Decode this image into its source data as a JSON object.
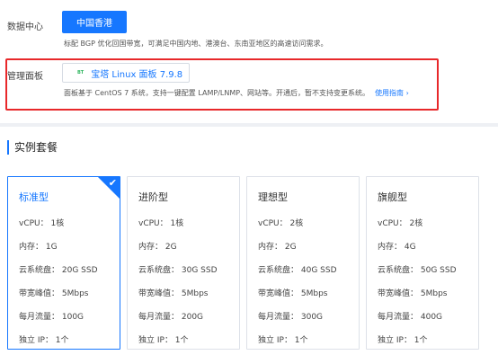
{
  "datacenter": {
    "label": "数据中心",
    "selected_region": "中国香港",
    "description": "标配 BGP 优化回国带宽，可满足中国内地、港澳台、东南亚地区的高速访问需求。"
  },
  "management_panel": {
    "label": "管理面板",
    "selected_panel": "宝塔 Linux 面板 7.9.8",
    "logo_text": "BT",
    "description": "面板基于 CentOS 7 系统，支持一键配置 LAMP/LNMP、网站等。开通后，暂不支持变更系统。",
    "guide_link": "使用指南 ›"
  },
  "plans_section": {
    "title": "实例套餐",
    "plans": [
      {
        "name": "标准型",
        "selected": true,
        "specs": [
          "vCPU：  1核",
          "内存：  1G",
          "云系统盘：  20G SSD",
          "带宽峰值：  5Mbps",
          "每月流量：  100G",
          "独立 IP：  1个"
        ]
      },
      {
        "name": "进阶型",
        "selected": false,
        "specs": [
          "vCPU：  1核",
          "内存：  2G",
          "云系统盘：  30G SSD",
          "带宽峰值：  5Mbps",
          "每月流量：  200G",
          "独立 IP：  1个"
        ]
      },
      {
        "name": "理想型",
        "selected": false,
        "specs": [
          "vCPU：  2核",
          "内存：  2G",
          "云系统盘：  40G SSD",
          "带宽峰值：  5Mbps",
          "每月流量：  300G",
          "独立 IP：  1个"
        ]
      },
      {
        "name": "旗舰型",
        "selected": false,
        "specs": [
          "vCPU：  2核",
          "内存：  4G",
          "云系统盘：  50G SSD",
          "带宽峰值：  5Mbps",
          "每月流量：  400G",
          "独立 IP：  1个"
        ]
      }
    ]
  },
  "icons": {
    "selected_check": "check-icon",
    "link_arrow": "chevron-right-icon"
  },
  "colors": {
    "accent": "#1677ff",
    "highlight_border": "#e8282a",
    "bt_green": "#2db55d"
  }
}
